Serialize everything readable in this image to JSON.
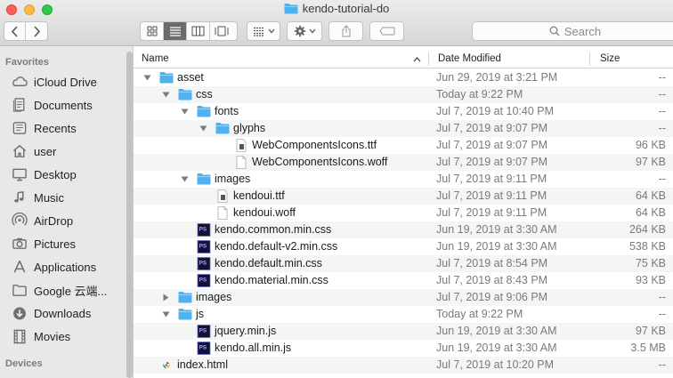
{
  "window": {
    "title": "kendo-tutorial-do"
  },
  "toolbar": {
    "back_icon": "chevron-left-icon",
    "forward_icon": "chevron-right-icon",
    "view_modes": [
      "icon-view",
      "list-view",
      "column-view",
      "gallery-view"
    ],
    "active_view": "list-view",
    "search_placeholder": "Search"
  },
  "sidebar": {
    "favorites_label": "Favorites",
    "devices_label": "Devices",
    "items": [
      {
        "label": "iCloud Drive",
        "icon": "cloud-icon"
      },
      {
        "label": "Documents",
        "icon": "documents-icon"
      },
      {
        "label": "Recents",
        "icon": "clock-icon"
      },
      {
        "label": "user",
        "icon": "home-icon"
      },
      {
        "label": "Desktop",
        "icon": "desktop-icon"
      },
      {
        "label": "Music",
        "icon": "music-icon"
      },
      {
        "label": "AirDrop",
        "icon": "airdrop-icon"
      },
      {
        "label": "Pictures",
        "icon": "camera-icon"
      },
      {
        "label": "Applications",
        "icon": "applications-icon"
      },
      {
        "label": "Google 云端...",
        "icon": "folder-icon"
      },
      {
        "label": "Downloads",
        "icon": "download-icon"
      },
      {
        "label": "Movies",
        "icon": "film-icon"
      }
    ]
  },
  "columns": {
    "name": "Name",
    "date": "Date Modified",
    "size": "Size"
  },
  "files": [
    {
      "name": "asset",
      "date": "Jun 29, 2019 at 3:21 PM",
      "size": "--",
      "depth": 0,
      "type": "folder",
      "disclosure": "open"
    },
    {
      "name": "css",
      "date": "Today at 9:22 PM",
      "size": "--",
      "depth": 1,
      "type": "folder",
      "disclosure": "open"
    },
    {
      "name": "fonts",
      "date": "Jul 7, 2019 at 10:40 PM",
      "size": "--",
      "depth": 2,
      "type": "folder",
      "disclosure": "open"
    },
    {
      "name": "glyphs",
      "date": "Jul 7, 2019 at 9:07 PM",
      "size": "--",
      "depth": 3,
      "type": "folder",
      "disclosure": "open"
    },
    {
      "name": "WebComponentsIcons.ttf",
      "date": "Jul 7, 2019 at 9:07 PM",
      "size": "96 KB",
      "depth": 4,
      "type": "font",
      "disclosure": "none"
    },
    {
      "name": "WebComponentsIcons.woff",
      "date": "Jul 7, 2019 at 9:07 PM",
      "size": "97 KB",
      "depth": 4,
      "type": "doc",
      "disclosure": "none"
    },
    {
      "name": "images",
      "date": "Jul 7, 2019 at 9:11 PM",
      "size": "--",
      "depth": 2,
      "type": "folder",
      "disclosure": "open"
    },
    {
      "name": "kendoui.ttf",
      "date": "Jul 7, 2019 at 9:11 PM",
      "size": "64 KB",
      "depth": 3,
      "type": "font",
      "disclosure": "none"
    },
    {
      "name": "kendoui.woff",
      "date": "Jul 7, 2019 at 9:11 PM",
      "size": "64 KB",
      "depth": 3,
      "type": "doc",
      "disclosure": "none"
    },
    {
      "name": "kendo.common.min.css",
      "date": "Jun 19, 2019 at 3:30 AM",
      "size": "264 KB",
      "depth": 2,
      "type": "ps",
      "disclosure": "none"
    },
    {
      "name": "kendo.default-v2.min.css",
      "date": "Jun 19, 2019 at 3:30 AM",
      "size": "538 KB",
      "depth": 2,
      "type": "ps",
      "disclosure": "none"
    },
    {
      "name": "kendo.default.min.css",
      "date": "Jul 7, 2019 at 8:54 PM",
      "size": "75 KB",
      "depth": 2,
      "type": "ps",
      "disclosure": "none"
    },
    {
      "name": "kendo.material.min.css",
      "date": "Jul 7, 2019 at 8:43 PM",
      "size": "93 KB",
      "depth": 2,
      "type": "ps",
      "disclosure": "none"
    },
    {
      "name": "images",
      "date": "Jul 7, 2019 at 9:06 PM",
      "size": "--",
      "depth": 1,
      "type": "folder",
      "disclosure": "closed"
    },
    {
      "name": "js",
      "date": "Today at 9:22 PM",
      "size": "--",
      "depth": 1,
      "type": "folder",
      "disclosure": "open"
    },
    {
      "name": "jquery.min.js",
      "date": "Jun 19, 2019 at 3:30 AM",
      "size": "97 KB",
      "depth": 2,
      "type": "ps",
      "disclosure": "none"
    },
    {
      "name": "kendo.all.min.js",
      "date": "Jun 19, 2019 at 3:30 AM",
      "size": "3.5 MB",
      "depth": 2,
      "type": "ps",
      "disclosure": "none"
    },
    {
      "name": "index.html",
      "date": "Jul 7, 2019 at 10:20 PM",
      "size": "--",
      "depth": 0,
      "type": "chrome",
      "disclosure": "none"
    }
  ],
  "colors": {
    "folder": "#4fb1ee",
    "ps_bg": "#111133",
    "ps_text": "#a7a7ff",
    "sidebar_bg": "#e9e8e9",
    "row_alt": "#f4f5f5"
  }
}
